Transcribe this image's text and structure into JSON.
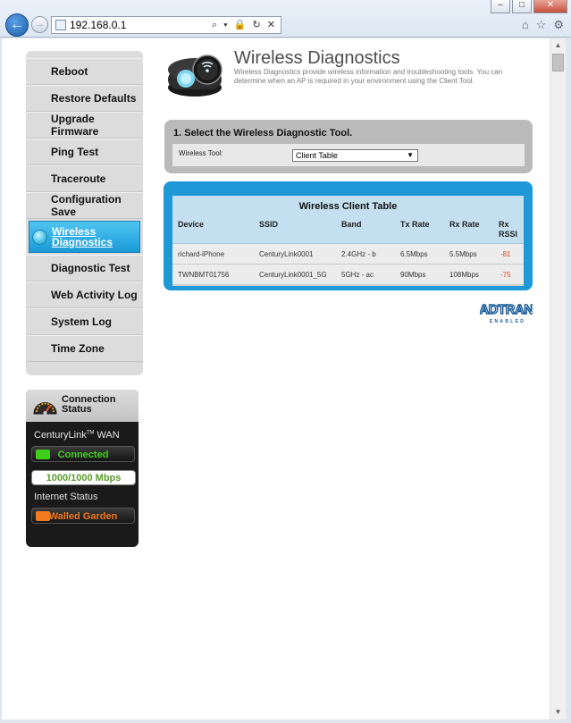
{
  "browser": {
    "address": "192.168.0.1",
    "address_tools": "⌕ ▾ 🔒 ↻ ✕",
    "window_buttons": {
      "minimize": "–",
      "maximize": "□",
      "close": "✕"
    }
  },
  "sidebar": {
    "items": [
      {
        "label": "Reboot"
      },
      {
        "label": "Restore Defaults"
      },
      {
        "label": "Upgrade Firmware"
      },
      {
        "label": "Ping Test"
      },
      {
        "label": "Traceroute"
      },
      {
        "label": "Configuration Save"
      },
      {
        "label": "Wireless Diagnostics",
        "active": true
      },
      {
        "label": "Diagnostic Test"
      },
      {
        "label": "Web Activity Log"
      },
      {
        "label": "System Log"
      },
      {
        "label": "Time Zone"
      }
    ]
  },
  "connection": {
    "title": "Connection Status",
    "brand": "CenturyLink",
    "brand_tm": "TM",
    "wan_label": "WAN",
    "wan_status": "Connected",
    "speed": "1000/1000 Mbps",
    "internet_label": "Internet Status",
    "internet_status": "Walled Garden"
  },
  "header": {
    "title": "Wireless Diagnostics",
    "description": "Wireless Diagnostics provide wireless information and troubleshooting tools. You can determine when an AP is required in your environment using the Client Tool."
  },
  "tool_selector": {
    "heading": "1. Select the Wireless Diagnostic Tool.",
    "label": "Wireless Tool:",
    "selected": "Client Table"
  },
  "client_table": {
    "title": "Wireless Client Table",
    "columns": [
      "Device",
      "SSID",
      "Band",
      "Tx Rate",
      "Rx Rate",
      "Rx RSSI"
    ],
    "rows": [
      [
        "richard-iPhone",
        "CenturyLink0001",
        "2.4GHz - b",
        "6.5Mbps",
        "5.5Mbps",
        "-81"
      ],
      [
        "TWNBMT01756",
        "CenturyLink0001_5G",
        "5GHz - ac",
        "90Mbps",
        "108Mbps",
        "-75"
      ]
    ]
  },
  "logo": {
    "name": "ADTRAN",
    "tagline": "ENABLED"
  },
  "colors": {
    "accent_blue": "#1e98d7",
    "status_green": "#43d11f",
    "status_orange": "#f07a19",
    "rssi_red": "#e04a24"
  }
}
